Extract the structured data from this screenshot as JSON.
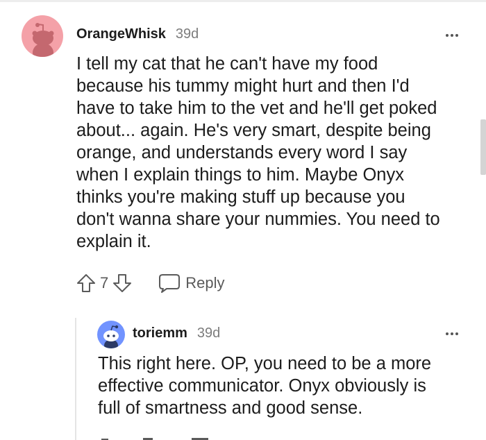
{
  "comments": [
    {
      "username": "OrangeWhisk",
      "timestamp": "39d",
      "avatar_icon": "snoo-avatar-icon",
      "avatar_bg": "#f4a1a8",
      "lines": [
        "I tell my cat that he can't have my food",
        "because his tummy might hurt and then I'd",
        "have to take him to the vet and he'll get poked",
        "about... again. He's very smart, despite being",
        "orange, and understands every word I say",
        "when I explain things to him. Maybe Onyx",
        "thinks you're making stuff up because you",
        "don't wanna share your nummies. You need to",
        "explain it."
      ],
      "score": "7",
      "reply_label": "Reply",
      "more_icon": "more-options-icon"
    },
    {
      "username": "toriemm",
      "timestamp": "39d",
      "avatar_icon": "snoo-avatar-icon",
      "avatar_bg": "#7193ff",
      "lines": [
        "This right here. OP, you need to be a more",
        "effective communicator. Onyx obviously is",
        "full of smartness and good sense."
      ],
      "more_icon": "more-options-icon"
    }
  ],
  "colors": {
    "text": "#1c1c1c",
    "meta": "#7c7c7c",
    "icon": "#5a5a5a"
  }
}
